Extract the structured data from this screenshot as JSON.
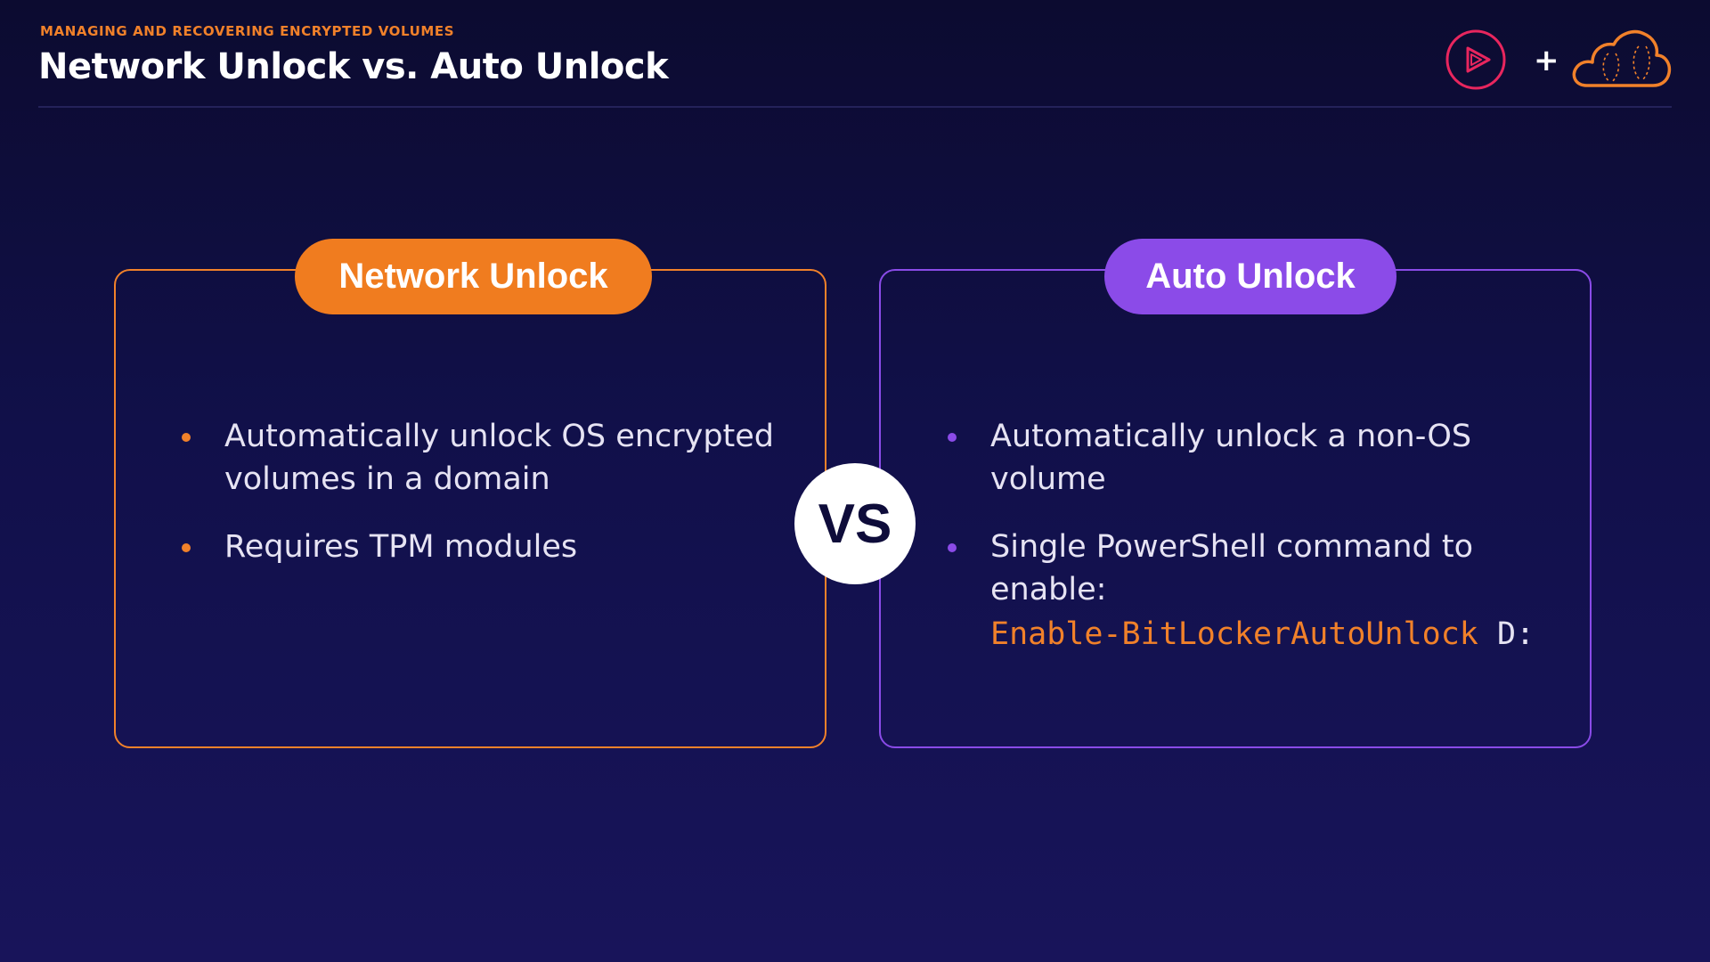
{
  "header": {
    "eyebrow": "MANAGING AND RECOVERING ENCRYPTED VOLUMES",
    "title": "Network Unlock vs. Auto Unlock",
    "plus": "+"
  },
  "left_panel": {
    "heading": "Network Unlock",
    "bullets": [
      "Automatically unlock OS encrypted volumes in a domain",
      "Requires TPM modules"
    ]
  },
  "right_panel": {
    "heading": "Auto Unlock",
    "bullets": [
      "Automatically unlock a non-OS volume",
      "Single PowerShell command to enable:"
    ],
    "code_command": "Enable-BitLockerAutoUnlock",
    "code_argument": "D:"
  },
  "vs": "VS",
  "icons": {
    "play_logo": "play-circle-icon",
    "cloud_logo": "cloud-icon"
  },
  "colors": {
    "accent_orange": "#f1812a",
    "accent_purple": "#8b4be8",
    "background": "#11104a"
  }
}
